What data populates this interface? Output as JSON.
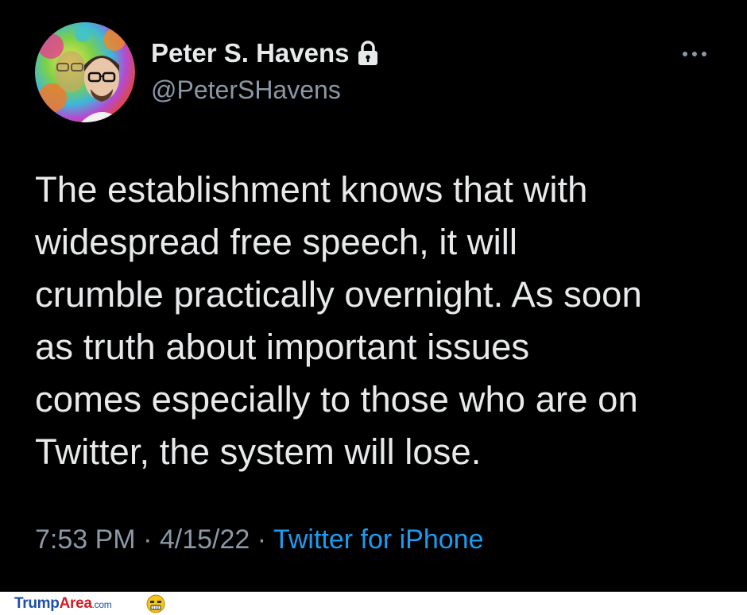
{
  "tweet": {
    "author": {
      "name": "Peter S. Havens",
      "handle": "@PeterSHavens",
      "protected": true
    },
    "text": "The establishment knows that with\nwidespread free speech, it will\ncrumble practically overnight. As soon\nas truth about important issues\ncomes especially to those who are on\nTwitter, the system will lose.",
    "time": "7:53 PM",
    "separator": "·",
    "date": "4/15/22",
    "source": "Twitter for iPhone"
  },
  "watermark": {
    "brand_main": "Trump",
    "brand_accent": "Area",
    "brand_suffix": ".com"
  },
  "icons": {
    "lock": "lock-icon",
    "more": "more-horizontal-icon",
    "avatar": "avatar-image"
  },
  "colors": {
    "background": "#000000",
    "text_primary": "#e7e9ea",
    "text_secondary": "#8b98a5",
    "link": "#1d9bf0"
  }
}
